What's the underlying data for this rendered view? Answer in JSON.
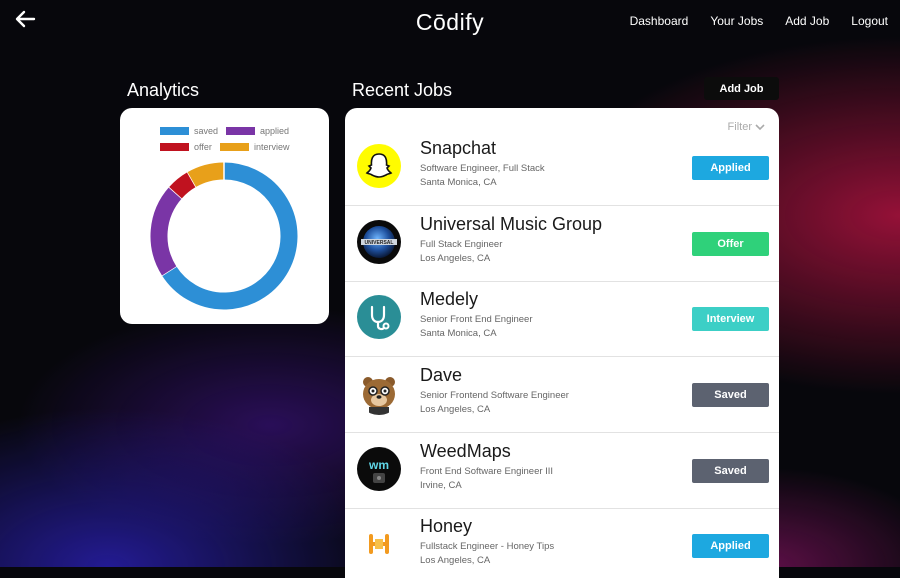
{
  "app": {
    "title": "Cōdify"
  },
  "nav": {
    "items": [
      "Dashboard",
      "Your Jobs",
      "Add Job",
      "Logout"
    ]
  },
  "analytics": {
    "title": "Analytics",
    "legend": [
      {
        "label": "saved",
        "color": "#2D8FD6"
      },
      {
        "label": "applied",
        "color": "#7A35A6"
      },
      {
        "label": "offer",
        "color": "#C0121F"
      },
      {
        "label": "interview",
        "color": "#E8A01A"
      }
    ],
    "chart_data": {
      "type": "pie",
      "variant": "donut",
      "categories": [
        "saved",
        "applied",
        "offer",
        "interview"
      ],
      "values": [
        64,
        20,
        5,
        8
      ]
    }
  },
  "recent_jobs": {
    "title": "Recent Jobs",
    "add_job_label": "Add Job",
    "filter_label": "Filter",
    "jobs": [
      {
        "company": "Snapchat",
        "role": "Software Engineer, Full Stack",
        "location": "Santa Monica, CA",
        "status": "Applied",
        "status_color": "#1DA8E0",
        "logo_icon": "snapchat-ghost-icon"
      },
      {
        "company": "Universal Music Group",
        "role": "Full Stack Engineer",
        "location": "Los Angeles, CA",
        "status": "Offer",
        "status_color": "#2FD17A",
        "logo_icon": "universal-globe-icon"
      },
      {
        "company": "Medely",
        "role": "Senior Front End Engineer",
        "location": "Santa Monica, CA",
        "status": "Interview",
        "status_color": "#3CCFC6",
        "logo_icon": "stethoscope-icon"
      },
      {
        "company": "Dave",
        "role": "Senior Frontend Software Engineer",
        "location": "Los Angeles, CA",
        "status": "Saved",
        "status_color": "#5C6270",
        "logo_icon": "bear-icon"
      },
      {
        "company": "WeedMaps",
        "role": "Front End Software Engineer III",
        "location": "Irvine, CA",
        "status": "Saved",
        "status_color": "#5C6270",
        "logo_icon": "weedmaps-icon"
      },
      {
        "company": "Honey",
        "role": "Fullstack Engineer - Honey Tips",
        "location": "Los Angeles, CA",
        "status": "Applied",
        "status_color": "#1DA8E0",
        "logo_icon": "honey-icon"
      }
    ]
  }
}
